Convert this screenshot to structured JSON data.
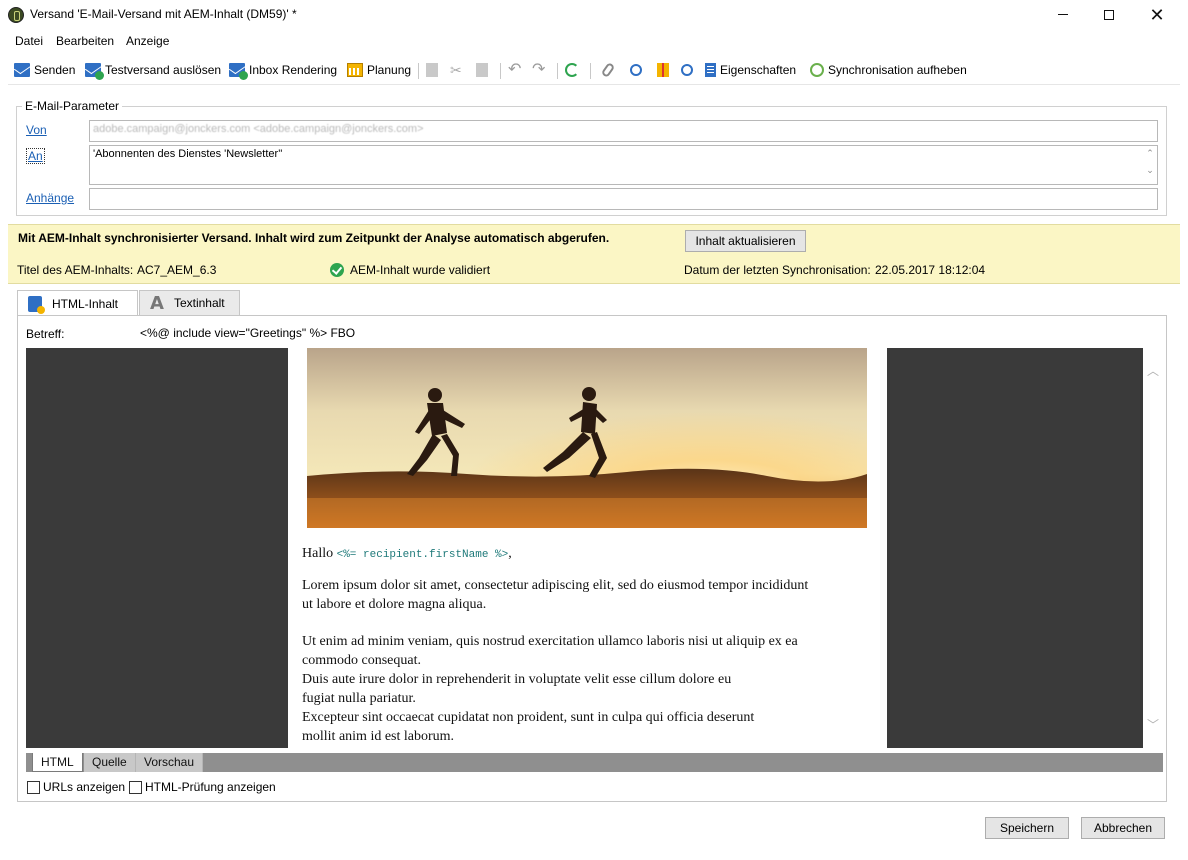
{
  "window": {
    "title": "Versand 'E-Mail-Versand mit AEM-Inhalt (DM59)' *",
    "minimize": "",
    "maximize": "",
    "close": "✕"
  },
  "menu": [
    "Datei",
    "Bearbeiten",
    "Anzeige"
  ],
  "toolbar": {
    "send": "Senden",
    "test_send": "Testversand auslösen",
    "inbox_rendering": "Inbox Rendering",
    "planning": "Planung",
    "properties": "Eigenschaften",
    "unsync": "Synchronisation aufheben",
    "undo_glyph": "↶",
    "redo_glyph": "↷"
  },
  "email_params": {
    "legend": "E-Mail-Parameter",
    "from_label": "Von",
    "from_value": "adobe.campaign@jonckers.com <adobe.campaign@jonckers.com>",
    "to_label": "An",
    "to_value": "'Abonnenten des Dienstes 'Newsletter''",
    "attachments_label": "Anhänge",
    "attachments_value": "",
    "scroll_up": "⌃",
    "scroll_down": "⌄"
  },
  "aem": {
    "message": "Mit AEM-Inhalt synchronisierter Versand. Inhalt wird zum Zeitpunkt der Analyse automatisch abgerufen.",
    "refresh_button": "Inhalt aktualisieren",
    "title_label": "Titel des AEM-Inhalts:",
    "title_value": "AC7_AEM_6.3",
    "validated": "AEM-Inhalt wurde validiert",
    "last_sync_label": "Datum der letzten Synchronisation:",
    "last_sync_value": "22.05.2017 18:12:04"
  },
  "tabs": [
    "HTML-Inhalt",
    "Textinhalt"
  ],
  "subject": {
    "label": "Betreff:",
    "value": "<%@ include view=\"Greetings\" %> FBO"
  },
  "email": {
    "greeting": "Hallo",
    "greeting_code": "<%= recipient.firstName %>",
    "greeting_suffix": ",",
    "lines": [
      "Lorem ipsum dolor sit amet, consectetur adipiscing elit, sed do eiusmod tempor incididunt",
      "ut labore et dolore magna aliqua.",
      "Ut enim ad minim veniam, quis nostrud exercitation ullamco laboris nisi ut aliquip ex ea",
      "commodo consequat.",
      "Duis aute irure dolor in reprehenderit in voluptate velit esse cillum dolore eu",
      "fugiat nulla pariatur.",
      "Excepteur sint occaecat cupidatat non proident, sunt in culpa qui officia deserunt",
      "mollit anim id est laborum."
    ],
    "scroll_up": "︿",
    "scroll_down": "﹀"
  },
  "editor_tabs": [
    "HTML",
    "Quelle",
    "Vorschau"
  ],
  "options": {
    "show_urls": "URLs anzeigen",
    "show_html_check": "HTML-Prüfung anzeigen"
  },
  "footer": {
    "save": "Speichern",
    "cancel": "Abbrechen"
  },
  "colors": {
    "aem_panel": "#fbf6c5",
    "link": "#1a5fb4",
    "accent_green": "#2ea44f",
    "dark_margin": "#3a3a3a"
  }
}
